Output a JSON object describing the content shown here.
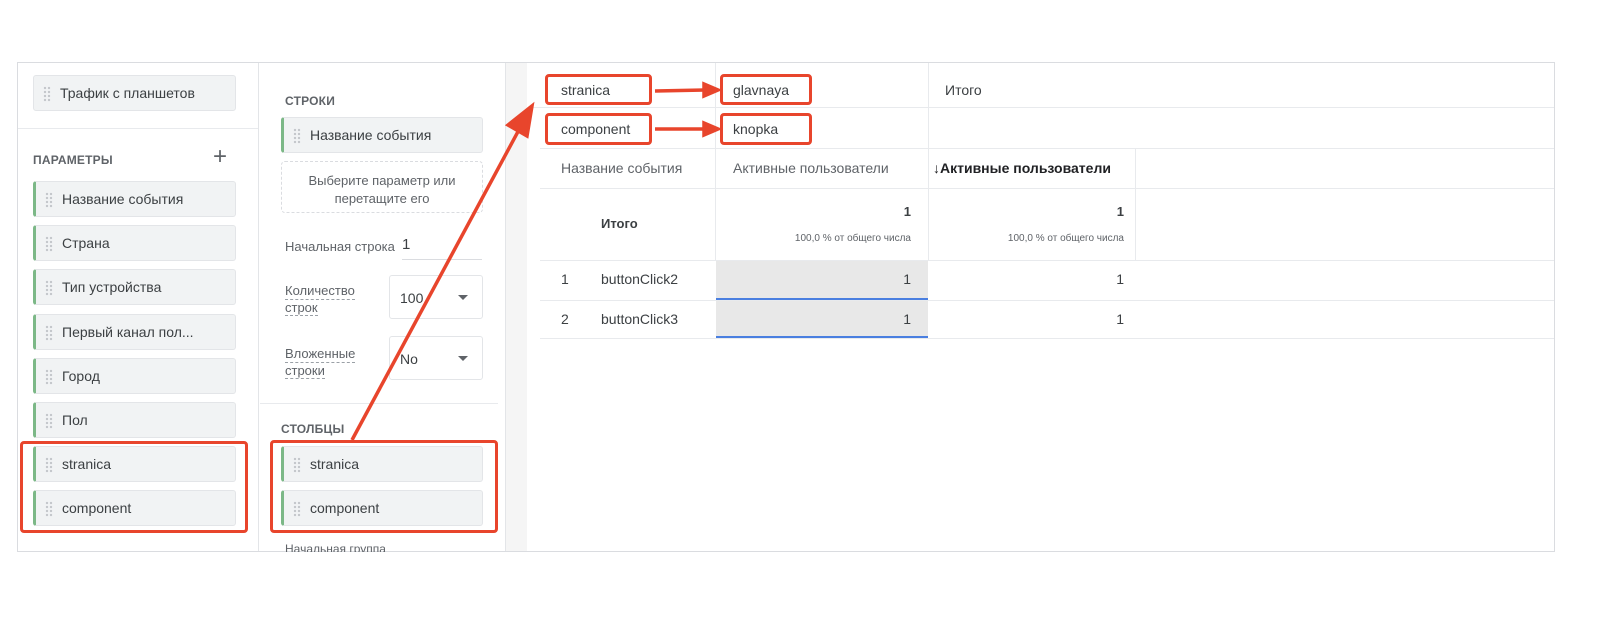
{
  "left_panel": {
    "segment_chip": "Трафик с планшетов",
    "section_title": "ПАРАМЕТРЫ",
    "add_icon": "plus-icon",
    "dimensions": [
      "Название события",
      "Страна",
      "Тип устройства",
      "Первый канал пол...",
      "Город",
      "Пол",
      "stranica",
      "component"
    ]
  },
  "settings_panel": {
    "rows_title": "СТРОКИ",
    "rows_chip": "Название события",
    "drop_zone": "Выберите параметр или перетащите его",
    "start_row_label": "Начальная строка",
    "start_row_value": "1",
    "row_count_label_1": "Количество",
    "row_count_label_2": "строк",
    "row_count_value": "100",
    "nested_label_1": "Вложенные",
    "nested_label_2": "строки",
    "nested_value": "No",
    "columns_title": "СТОЛБЦЫ",
    "columns_chips": [
      "stranica",
      "component"
    ],
    "start_group_label": "Начальная группа"
  },
  "table": {
    "pivot_dims": [
      "stranica",
      "component"
    ],
    "pivot_values": [
      "glavnaya",
      "knopka"
    ],
    "total_col_label": "Итого",
    "headers": [
      "Название события",
      "Активные пользователи",
      "↓Активные пользователи"
    ],
    "total_row": {
      "label": "Итого",
      "values": [
        "1",
        "1"
      ],
      "subtitles": [
        "100,0 % от общего числа",
        "100,0 % от общего числа"
      ]
    },
    "rows": [
      {
        "index": "1",
        "name": "buttonClick2",
        "values": [
          "1",
          "1"
        ]
      },
      {
        "index": "2",
        "name": "buttonClick3",
        "values": [
          "1",
          "1"
        ]
      }
    ]
  },
  "colors": {
    "annotation": "#e8452c",
    "accent": "#4a7fe0",
    "chip_bar": "#7cb887"
  }
}
